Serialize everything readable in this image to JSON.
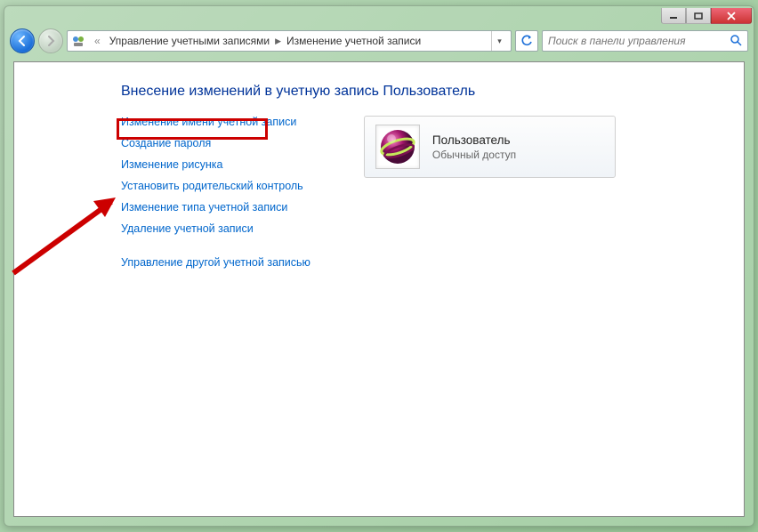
{
  "breadcrumb": {
    "prefix": "«",
    "level1": "Управление учетными записями",
    "level2": "Изменение учетной записи"
  },
  "search": {
    "placeholder": "Поиск в панели управления"
  },
  "page": {
    "title": "Внесение изменений в учетную запись Пользователь"
  },
  "links": {
    "l0": "Изменение имени учетной записи",
    "l1": "Создание пароля",
    "l2": "Изменение рисунка",
    "l3": "Установить родительский контроль",
    "l4": "Изменение типа учетной записи",
    "l5": "Удаление учетной записи",
    "l6": "Управление другой учетной записью"
  },
  "user": {
    "name": "Пользователь",
    "type": "Обычный доступ"
  }
}
